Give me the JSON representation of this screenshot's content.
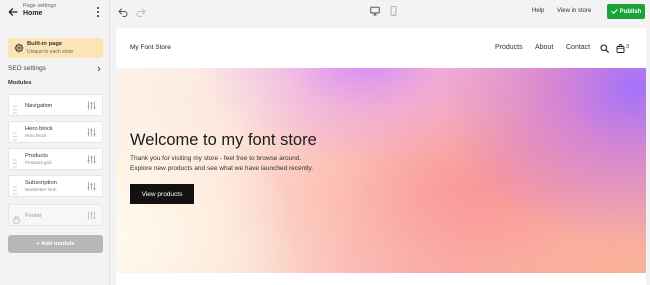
{
  "sidebar": {
    "header": {
      "subtitle": "Page settings",
      "title": "Home"
    },
    "builtin": {
      "title": "Built-in page",
      "subtitle": "Unique to each store"
    },
    "seo_label": "SEO settings",
    "modules_label": "Modules",
    "modules": [
      {
        "name": "Navigation",
        "subtitle": "",
        "disabled": false
      },
      {
        "name": "Hero block",
        "subtitle": "Hero block",
        "disabled": false
      },
      {
        "name": "Products",
        "subtitle": "Products grid",
        "disabled": false
      },
      {
        "name": "Subscription",
        "subtitle": "Newsletter form",
        "disabled": false
      },
      {
        "name": "Footer",
        "subtitle": "",
        "disabled": true
      }
    ],
    "add_module_label": "+ Add module"
  },
  "toolbar": {
    "help_label": "Help",
    "view_in_store_label": "View in store",
    "publish_label": "Publish",
    "icons": [
      "undo-icon",
      "redo-icon",
      "desktop-icon",
      "mobile-icon",
      "check-icon"
    ]
  },
  "preview": {
    "store_name": "My Font Store",
    "nav_links": [
      "Products",
      "About",
      "Contact"
    ],
    "cart_count": "3",
    "hero": {
      "title": "Welcome to my font store",
      "text_line1": "Thank you for visiting my store - feel free to browse around.",
      "text_line2": "Explore new products and see what we have launched recently.",
      "button_label": "View products"
    }
  },
  "colors": {
    "accent": "#1aa33a",
    "builtin_bg": "#fbe5b6",
    "add_module_bg": "#b7b7b7",
    "hero_button_bg": "#111111"
  }
}
